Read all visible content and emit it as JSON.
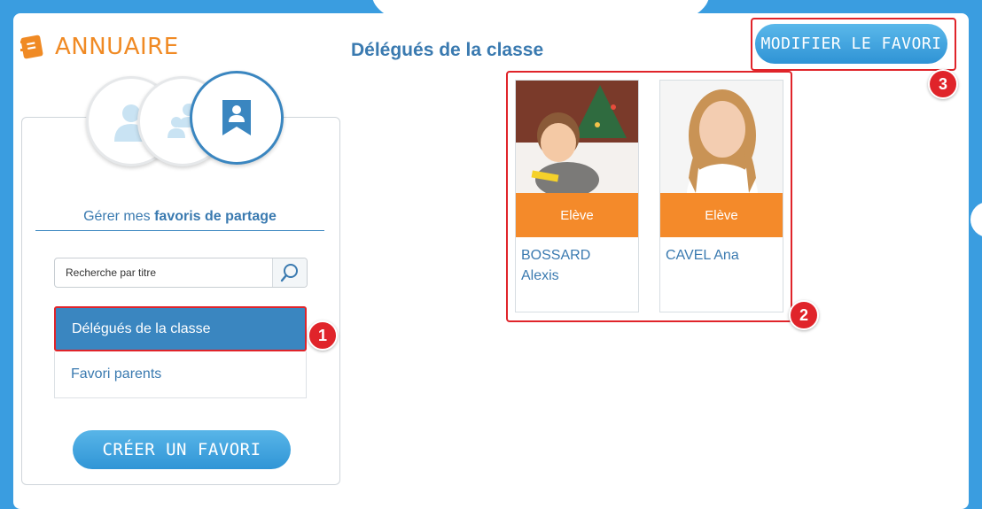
{
  "app": {
    "title": "ANNUAIRE"
  },
  "sidebar": {
    "section_title_prefix": "Gérer mes ",
    "section_title_bold": "favoris de partage",
    "search": {
      "placeholder": "Recherche par titre"
    },
    "favorites": [
      {
        "label": "Délégués de la classe",
        "selected": true
      },
      {
        "label": "Favori parents",
        "selected": false
      }
    ],
    "create_button": "CRÉER UN FAVORI"
  },
  "main": {
    "title": "Délégués de la classe",
    "modify_button": "MODIFIER LE FAVORI",
    "members": [
      {
        "role": "Elève",
        "name_line1": "BOSSARD",
        "name_line2": "Alexis"
      },
      {
        "role": "Elève",
        "name_line1": "CAVEL Ana",
        "name_line2": ""
      }
    ]
  },
  "annotations": [
    "1",
    "2",
    "3"
  ],
  "colors": {
    "accent_blue": "#3a86c0",
    "orange": "#f48a2a",
    "highlight_red": "#e0242a"
  }
}
